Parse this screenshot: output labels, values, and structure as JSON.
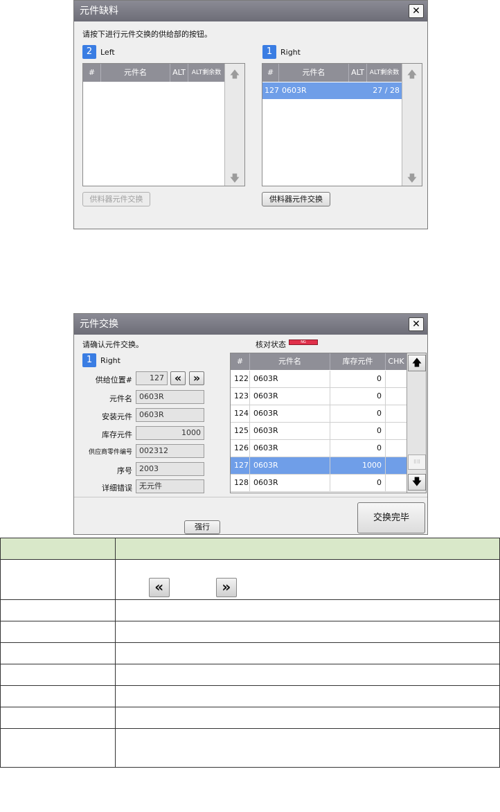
{
  "dialog1": {
    "title": "元件缺料",
    "instruction": "请按下进行元件交换的供给部的按钮。",
    "left": {
      "badge": "2",
      "label": "Left",
      "columns": [
        "#",
        "元件名",
        "ALT",
        "ALT剩余数"
      ],
      "button": "供料器元件交换"
    },
    "right": {
      "badge": "1",
      "label": "Right",
      "columns": [
        "#",
        "元件名",
        "ALT",
        "ALT剩余数"
      ],
      "row": {
        "num": "127",
        "name": "0603R",
        "alt": "",
        "remaining": "27 / 28"
      },
      "button": "供料器元件交换"
    }
  },
  "dialog2": {
    "title": "元件交换",
    "instruction": "请确认元件交换。",
    "check_status_label": "核对状态",
    "check_status_bar_text": "NG",
    "side": {
      "badge": "1",
      "label": "Right"
    },
    "fields": {
      "feed_position_label": "供给位置#",
      "feed_position_value": "127",
      "part_name_label": "元件名",
      "part_name_value": "0603R",
      "mounted_label": "安装元件",
      "mounted_value": "0603R",
      "stock_label": "库存元件",
      "stock_value": "1000",
      "supplier_no_label": "供应商零件编号",
      "supplier_no_value": "002312",
      "serial_label": "序号",
      "serial_value": "2003",
      "error_label": "详细错误",
      "error_value": "无元件"
    },
    "grid": {
      "columns": [
        "#",
        "元件名",
        "库存元件",
        "CHK"
      ],
      "rows": [
        {
          "num": "122",
          "name": "0603R",
          "stock": "0",
          "chk": ""
        },
        {
          "num": "123",
          "name": "0603R",
          "stock": "0",
          "chk": ""
        },
        {
          "num": "124",
          "name": "0603R",
          "stock": "0",
          "chk": ""
        },
        {
          "num": "125",
          "name": "0603R",
          "stock": "0",
          "chk": ""
        },
        {
          "num": "126",
          "name": "0603R",
          "stock": "0",
          "chk": ""
        },
        {
          "num": "127",
          "name": "0603R",
          "stock": "1000",
          "chk": ""
        },
        {
          "num": "128",
          "name": "0603R",
          "stock": "0",
          "chk": ""
        }
      ]
    },
    "force_button": "强行",
    "finish_button": "交换完毕"
  },
  "colors": {
    "titlebar": "#7c7c86",
    "selection": "#6f9ee8",
    "badge": "#3a7de3",
    "status_ng": "#e0304a",
    "table_header": "#d9e8c9"
  }
}
